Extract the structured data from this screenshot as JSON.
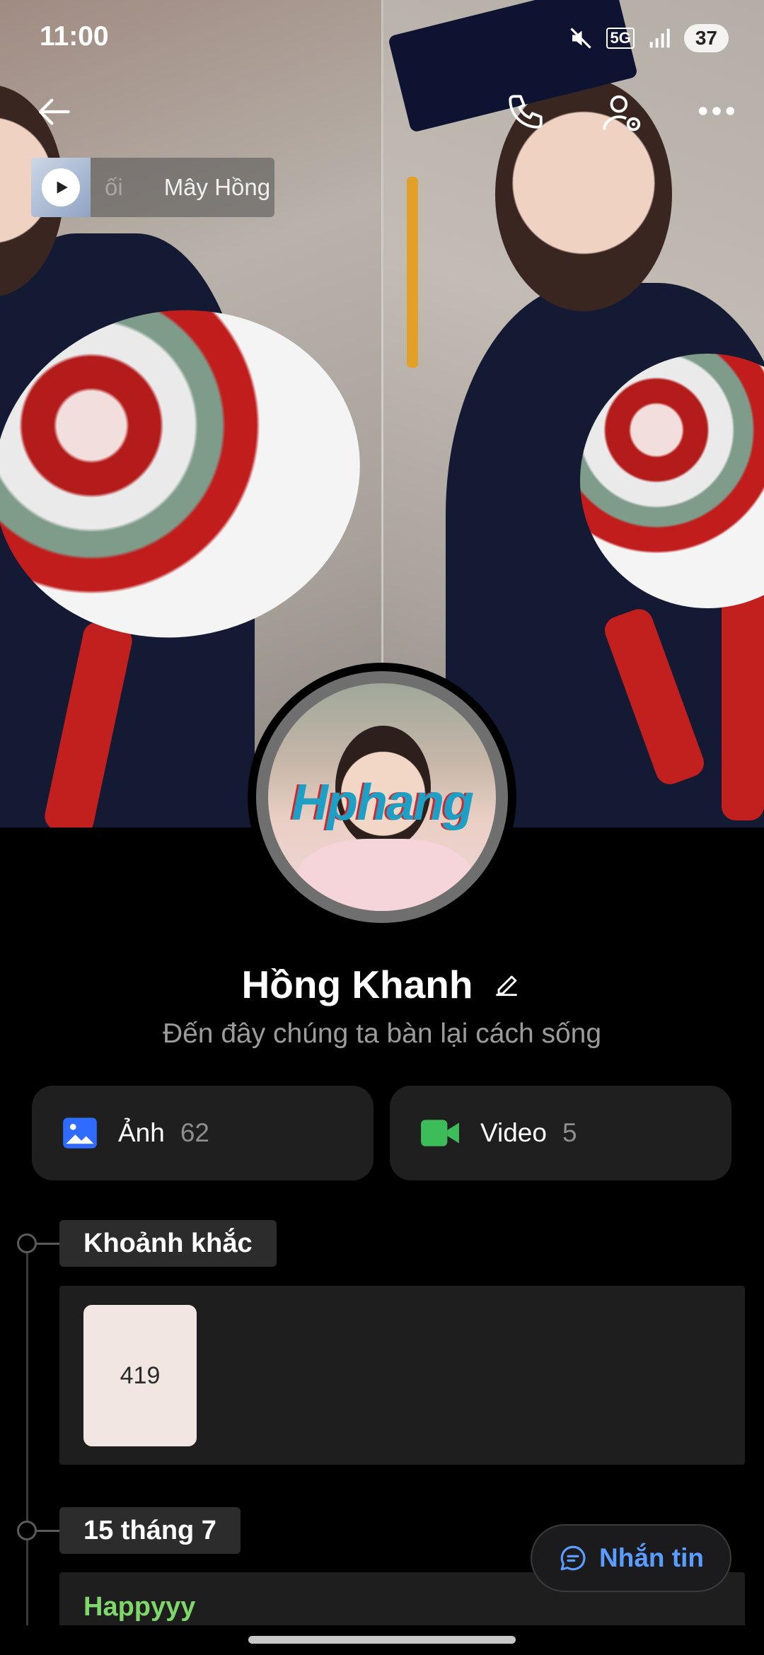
{
  "status_bar": {
    "time": "11:00",
    "network": "5G",
    "battery": "37",
    "icons": [
      "mute-icon",
      "signal-icon",
      "battery-icon"
    ]
  },
  "top_bar": {
    "icons": [
      "back-arrow-icon",
      "phone-icon",
      "friend-settings-icon",
      "more-icon"
    ]
  },
  "music": {
    "faded_text": "ối",
    "title": "Mây Hồng",
    "thumbnail_label": "Mây Hồng"
  },
  "avatar": {
    "watermark": "Hphang"
  },
  "profile": {
    "name": "Hồng Khanh",
    "status": "Đến đây chúng ta bàn lại cách sống"
  },
  "media": {
    "photos": {
      "label": "Ảnh",
      "count": "62",
      "icon": "image-icon",
      "color": "#2f6bff"
    },
    "videos": {
      "label": "Video",
      "count": "5",
      "icon": "video-camera-icon",
      "color": "#3dbd5a"
    }
  },
  "timeline": {
    "moments": {
      "title": "Khoảnh khắc",
      "tile_count": "419"
    },
    "date_section": {
      "date": "15 tháng 7",
      "post_text": "Happyyy"
    }
  },
  "message_button": {
    "label": "Nhắn tin",
    "icon": "chat-bubble-icon",
    "color": "#5b9cff"
  },
  "colors": {
    "background": "#000000",
    "card": "#1f1f1f",
    "post_text": "#7fd66a",
    "muted_text": "#9b9b9b"
  }
}
